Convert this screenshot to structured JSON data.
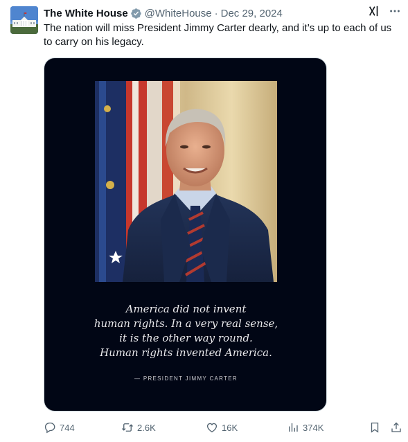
{
  "author": {
    "display_name": "The White House",
    "handle": "@WhiteHouse",
    "separator": "·",
    "date": "Dec 29, 2024",
    "verified_icon": "verified-badge-icon",
    "avatar": "white-house-building"
  },
  "tweet": {
    "text": "The nation will miss President Jimmy Carter dearly, and it’s up to each of us to carry on his legacy."
  },
  "media": {
    "portrait": "president-jimmy-carter-portrait",
    "quote_lines": [
      "America did not invent",
      "human rights. In a very real sense,",
      "it is the other way round.",
      "Human rights invented America."
    ],
    "attribution": "— PRESIDENT JIMMY CARTER"
  },
  "actions": {
    "replies": "744",
    "reposts": "2.6K",
    "likes": "16K",
    "views": "374K"
  },
  "colors": {
    "text": "#0f1419",
    "secondary": "#536471",
    "media_bg": "#010615",
    "verified": "#829aab"
  }
}
